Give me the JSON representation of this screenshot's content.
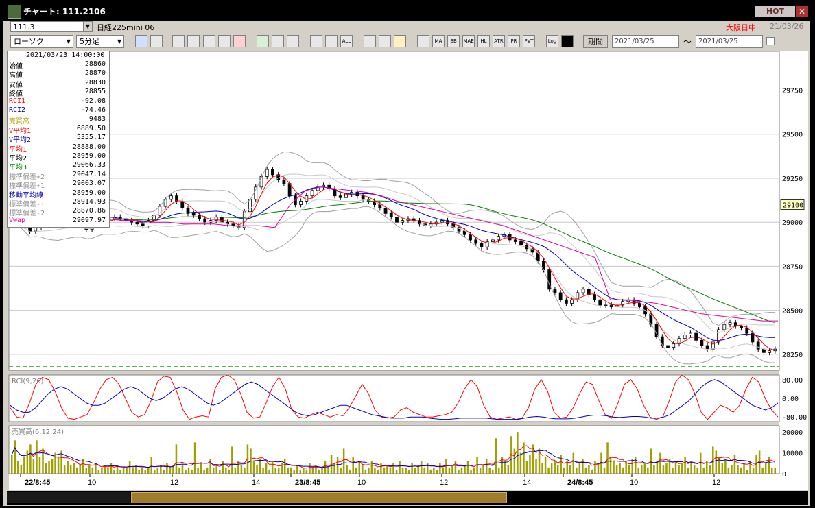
{
  "window": {
    "title": "チャート: 111.2106",
    "hot_label": "HOT",
    "close_label": "✕"
  },
  "header": {
    "code": "111.3",
    "symbol": "日経225mini 06",
    "exchange": "大阪日中",
    "date": "21/03/26"
  },
  "toolbar": {
    "chart_type": "ローソク",
    "interval": "5分足",
    "buttons": [
      "search",
      "cross",
      "down",
      "zoom",
      "tile",
      "grid",
      "flag",
      "draw",
      "trend",
      "flip",
      "ohlc",
      "box",
      "all",
      "fib",
      "pen",
      "color",
      "ma_a",
      "ma",
      "bb",
      "mae",
      "hl",
      "atr",
      "pr",
      "pvt",
      "log",
      "copy"
    ],
    "button_labels": {
      "all": "ALL",
      "ma": "MA",
      "bb": "BB",
      "mae": "MAE",
      "hl": "HL",
      "atr": "ATR",
      "pr": "PR",
      "pvt": "PVT",
      "log": "Log"
    },
    "period_label": "期間",
    "date_from": "2021/03/25",
    "date_to": "2021/03/25",
    "tilde": "～"
  },
  "info_panel": {
    "timestamp": "2021/03/23  14:00:00",
    "rows": [
      {
        "label": "始値",
        "value": "28860",
        "color": "#000000"
      },
      {
        "label": "高値",
        "value": "28870",
        "color": "#000000"
      },
      {
        "label": "安値",
        "value": "28830",
        "color": "#000000"
      },
      {
        "label": "終値",
        "value": "28855",
        "color": "#000000"
      },
      {
        "label": "RCI1",
        "value": "-92.08",
        "color": "#ff0000"
      },
      {
        "label": "RCI2",
        "value": "-74.46",
        "color": "#0000c0"
      },
      {
        "label": "売買高",
        "value": "9483",
        "color": "#b0a000"
      },
      {
        "label": "V平均1",
        "value": "6889.50",
        "color": "#ff0000"
      },
      {
        "label": "V平均2",
        "value": "5355.17",
        "color": "#0000c0"
      },
      {
        "label": "平均1",
        "value": "28888.00",
        "color": "#ff0000"
      },
      {
        "label": "平均2",
        "value": "28959.00",
        "color": "#000000"
      },
      {
        "label": "平均3",
        "value": "29066.33",
        "color": "#008000"
      },
      {
        "label": "標準偏差+2",
        "value": "29047.14",
        "color": "#909090"
      },
      {
        "label": "標準偏差+1",
        "value": "29003.07",
        "color": "#909090"
      },
      {
        "label": "移動平均線",
        "value": "28959.00",
        "color": "#0000c0"
      },
      {
        "label": "標準偏差-1",
        "value": "28914.93",
        "color": "#909090"
      },
      {
        "label": "標準偏差-2",
        "value": "28870.86",
        "color": "#909090"
      },
      {
        "label": "Vwap",
        "value": "29097.97",
        "color": "#e000a0"
      }
    ]
  },
  "chart_data": [
    {
      "type": "candlestick",
      "title": "",
      "y_ticks": [
        29750,
        29500,
        29250,
        29000,
        28750,
        28500,
        28250
      ],
      "ylim": [
        28160,
        29970
      ],
      "current_price_label": "29100",
      "dashed_line_value": 28180,
      "x_tick_labels": [
        {
          "label": "22/8:45",
          "bold": true
        },
        {
          "label": "10",
          "bold": false
        },
        {
          "label": "12",
          "bold": false
        },
        {
          "label": "14",
          "bold": false
        },
        {
          "label": "23/8:45",
          "bold": true
        },
        {
          "label": "10",
          "bold": false
        },
        {
          "label": "12",
          "bold": false
        },
        {
          "label": "14",
          "bold": false
        },
        {
          "label": "24/8:45",
          "bold": true
        },
        {
          "label": "10",
          "bold": false
        },
        {
          "label": "12",
          "bold": false
        }
      ],
      "close_series": [
        29000,
        28980,
        28950,
        28970,
        29020,
        29060,
        29080,
        29100,
        29060,
        29040,
        29030,
        29000,
        28960,
        28990,
        29000,
        29010,
        29020,
        29030,
        29020,
        29010,
        29000,
        28990,
        28980,
        29010,
        29040,
        29090,
        29130,
        29150,
        29120,
        29080,
        29050,
        29040,
        29020,
        29000,
        29010,
        29030,
        29000,
        28990,
        28980,
        28970,
        29060,
        29130,
        29200,
        29260,
        29300,
        29270,
        29240,
        29220,
        29150,
        29100,
        29120,
        29150,
        29180,
        29200,
        29210,
        29190,
        29150,
        29140,
        29160,
        29170,
        29150,
        29130,
        29120,
        29100,
        29080,
        29050,
        29030,
        29000,
        29010,
        29020,
        29010,
        28990,
        28980,
        28990,
        29000,
        29010,
        28990,
        28970,
        28950,
        28930,
        28900,
        28880,
        28860,
        28890,
        28900,
        28920,
        28930,
        28900,
        28890,
        28870,
        28850,
        28830,
        28780,
        28730,
        28620,
        28600,
        28560,
        28540,
        28560,
        28600,
        28620,
        28590,
        28560,
        28530,
        28530,
        28520,
        28530,
        28550,
        28560,
        28540,
        28520,
        28480,
        28420,
        28350,
        28300,
        28290,
        28310,
        28340,
        28360,
        28370,
        28330,
        28300,
        28280,
        28320,
        28390,
        28420,
        28430,
        28410,
        28400,
        28370,
        28320,
        28280,
        28260,
        28270,
        28280
      ],
      "ma_short": {
        "name": "平均1",
        "color": "#ff0000"
      },
      "ma_mid": {
        "name": "移動平均線",
        "color": "#0000c0"
      },
      "ma_long": {
        "name": "平均3",
        "color": "#008000"
      },
      "vwap": {
        "name": "Vwap",
        "color": "#e000a0",
        "values": [
          29040,
          29050,
          29040,
          29030,
          29030,
          29020,
          29020,
          29010,
          29010,
          29000,
          29000,
          28990,
          28990,
          28990,
          28980,
          28980,
          28980,
          28970,
          29100,
          29180,
          29200,
          29190,
          29180,
          29170,
          29150,
          29120,
          29100,
          29080,
          29060,
          29040,
          29020,
          29000,
          28980,
          28950,
          28920,
          28890,
          28860,
          28830,
          28800,
          28560,
          28560,
          28550,
          28540,
          28520,
          28500,
          28480,
          28470,
          28460,
          28450,
          28440,
          28440
        ]
      }
    },
    {
      "type": "line",
      "title": "RCI(9,26)",
      "y_ticks": [
        80.0,
        0.0,
        -80.0
      ],
      "y_tick_labels": [
        "80.00",
        "0.00",
        "-80.00"
      ],
      "ylim": [
        -100,
        100
      ],
      "series": [
        {
          "name": "RCI1",
          "color": "#ff0000",
          "values": [
            -40,
            -80,
            -85,
            -20,
            60,
            90,
            80,
            30,
            -40,
            -85,
            -90,
            -80,
            -70,
            -20,
            40,
            80,
            90,
            60,
            0,
            -60,
            -80,
            -70,
            -10,
            70,
            95,
            90,
            30,
            -50,
            -90,
            -80,
            -75,
            -80,
            40,
            90,
            100,
            80,
            20,
            -60,
            -85,
            -80,
            -20,
            50,
            90,
            40,
            -50,
            -80,
            -85,
            -70,
            -60,
            -70,
            -80,
            -70,
            -75,
            -40,
            10,
            60,
            20,
            -50,
            -80,
            -85,
            -80,
            -50,
            -40,
            -60,
            -70,
            -80,
            -80,
            -75,
            -70,
            -60,
            -20,
            40,
            80,
            50,
            -30,
            -80,
            -90,
            -85,
            -80,
            -90,
            -85,
            -40,
            40,
            80,
            30,
            -60,
            -85,
            -80,
            -40,
            20,
            70,
            60,
            -10,
            -70,
            -85,
            -20,
            60,
            80,
            40,
            -30,
            -80,
            -90,
            -80,
            -10,
            70,
            100,
            80,
            20,
            -60,
            -90,
            -60,
            -30,
            -40,
            -60,
            -30,
            40,
            90,
            70,
            0,
            -50,
            -80
          ]
        },
        {
          "name": "RCI2",
          "color": "#0000c0",
          "values": [
            -30,
            -50,
            -60,
            -60,
            -40,
            -10,
            20,
            40,
            50,
            40,
            20,
            0,
            -20,
            -30,
            -30,
            -20,
            0,
            20,
            40,
            50,
            40,
            20,
            0,
            -10,
            0,
            20,
            40,
            50,
            40,
            20,
            0,
            -20,
            -30,
            -20,
            0,
            20,
            40,
            60,
            70,
            60,
            40,
            20,
            0,
            -20,
            -40,
            -60,
            -70,
            -75,
            -70,
            -60,
            -50,
            -40,
            -30,
            -30,
            -40,
            -50,
            -60,
            -70,
            -75,
            -80,
            -85,
            -85,
            -85,
            -80,
            -80,
            -80,
            -85,
            -88,
            -90,
            -90,
            -88,
            -85,
            -85,
            -85,
            -85,
            -85,
            -88,
            -90,
            -90,
            -90,
            -90,
            -85,
            -80,
            -78,
            -80,
            -85,
            -88,
            -88,
            -88,
            -85,
            -80,
            -75,
            -72,
            -72,
            -75,
            -80,
            -82,
            -80,
            -78,
            -78,
            -80,
            -85,
            -85,
            -80,
            -70,
            -50,
            -30,
            -10,
            20,
            50,
            70,
            80,
            70,
            50,
            30,
            10,
            -10,
            -30,
            -40,
            -50,
            -40,
            -20
          ]
        }
      ]
    },
    {
      "type": "bar",
      "title": "売買高(6,12,24)",
      "y_ticks": [
        20000,
        10000,
        0
      ],
      "ylim": [
        0,
        23000
      ],
      "bar_color": "#a0a000",
      "values": [
        9000,
        16000,
        6000,
        4000,
        8000,
        11000,
        14000,
        7000,
        16000,
        8000,
        12000,
        5000,
        6000,
        7000,
        10000,
        8000,
        11000,
        4000,
        6000,
        4000,
        5000,
        3000,
        4000,
        7000,
        3000,
        4000,
        3000,
        5000,
        2000,
        3000,
        4000,
        3000,
        5000,
        2000,
        4000,
        2000,
        3000,
        3000,
        6000,
        3000,
        4000,
        2000,
        3000,
        2000,
        3000,
        8000,
        2000,
        3000,
        4000,
        2000,
        5000,
        3000,
        4000,
        14000,
        3000,
        4000,
        2000,
        3000,
        2000,
        15000,
        3000,
        5000,
        2000,
        3000,
        7000,
        3000,
        4000,
        2000,
        6000,
        3000,
        2000,
        13000,
        3000,
        6000,
        4000,
        3000,
        14000,
        12000,
        6000,
        4000,
        7000,
        3000,
        5000,
        2000,
        6000,
        3000,
        3000,
        5000,
        7000,
        3000,
        3000,
        2000,
        4000,
        2000,
        3000,
        2000,
        5000,
        3000,
        4000,
        2000,
        3000,
        6000,
        3000,
        9000,
        5000,
        8000,
        3000,
        12000,
        4000,
        2000,
        8000,
        3000,
        6000,
        4000,
        2000,
        3000,
        6000,
        3000,
        2000,
        5000,
        3000,
        4000,
        3000,
        5000,
        2000,
        6000,
        3000,
        3000,
        2000,
        5000,
        3000,
        4000,
        6000,
        3000,
        5000,
        2000,
        3000,
        2000,
        5000,
        3000,
        7000,
        3000,
        4000,
        6000,
        2000,
        3000,
        4000,
        6000,
        2000,
        3000,
        8000,
        3000,
        4000,
        7000,
        3000,
        2000,
        17000,
        3000,
        8000,
        6000,
        4000,
        18000,
        12000,
        20000,
        10000,
        15000,
        6000,
        9000,
        14000,
        7000,
        12000,
        5000,
        8000,
        3000,
        5000,
        6000,
        4000,
        9000,
        3000,
        6000,
        4000,
        10000,
        3000,
        5000,
        7000,
        3000,
        4000,
        2000,
        6000,
        5000,
        10000,
        3000,
        15000,
        8000,
        6000,
        4000,
        5000,
        3000,
        6000,
        4000,
        7000,
        8000,
        3000,
        4000,
        5000,
        3000,
        12000,
        4000,
        6000,
        10000,
        4000,
        5000,
        7000,
        3000,
        6000,
        4000,
        5000,
        8000,
        3000,
        6000,
        4000,
        3000,
        10000,
        3000,
        6000,
        4000,
        13000,
        11000,
        8000,
        5000,
        7000,
        3000,
        4000,
        9000,
        4000,
        3000,
        5000,
        2000,
        6000,
        3000,
        9000,
        11000,
        3000,
        5000,
        8000,
        3000,
        3000
      ]
    }
  ]
}
